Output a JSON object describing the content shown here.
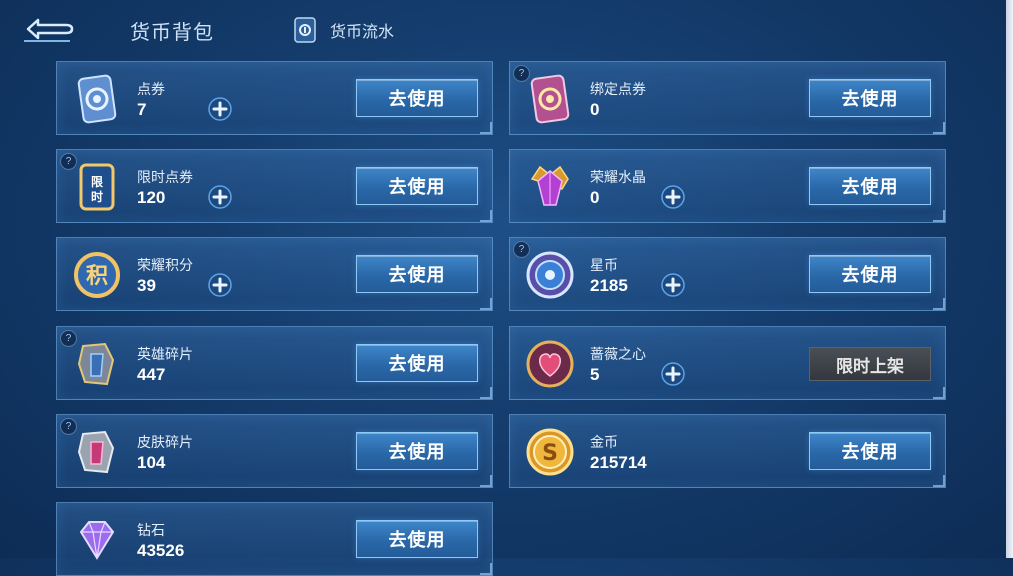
{
  "header": {
    "title": "货币背包",
    "flow_label": "货币流水"
  },
  "cards": [
    {
      "name": "点券",
      "amount": "7",
      "icon": "voucher-icon",
      "action": "去使用",
      "help": false,
      "plus": true
    },
    {
      "name": "绑定点券",
      "amount": "0",
      "icon": "bound-voucher-icon",
      "action": "去使用",
      "help": true,
      "plus": false
    },
    {
      "name": "限时点券",
      "amount": "120",
      "icon": "limited-voucher-icon",
      "action": "去使用",
      "help": true,
      "plus": true
    },
    {
      "name": "荣耀水晶",
      "amount": "0",
      "icon": "glory-crystal-icon",
      "action": "去使用",
      "help": false,
      "plus": true
    },
    {
      "name": "荣耀积分",
      "amount": "39",
      "icon": "glory-points-icon",
      "action": "去使用",
      "help": false,
      "plus": true
    },
    {
      "name": "星币",
      "amount": "2185",
      "icon": "star-coin-icon",
      "action": "去使用",
      "help": true,
      "plus": true
    },
    {
      "name": "英雄碎片",
      "amount": "447",
      "icon": "hero-fragment-icon",
      "action": "去使用",
      "help": true,
      "plus": false
    },
    {
      "name": "蔷薇之心",
      "amount": "5",
      "icon": "rose-heart-icon",
      "action": "限时上架",
      "help": false,
      "plus": true
    },
    {
      "name": "皮肤碎片",
      "amount": "104",
      "icon": "skin-fragment-icon",
      "action": "去使用",
      "help": true,
      "plus": false
    },
    {
      "name": "金币",
      "amount": "215714",
      "icon": "gold-coin-icon",
      "action": "去使用",
      "help": false,
      "plus": false
    },
    {
      "name": "钻石",
      "amount": "43526",
      "icon": "diamond-icon",
      "action": "去使用",
      "help": false,
      "plus": false
    }
  ],
  "help_glyph": "?",
  "plus_glyph": "+"
}
